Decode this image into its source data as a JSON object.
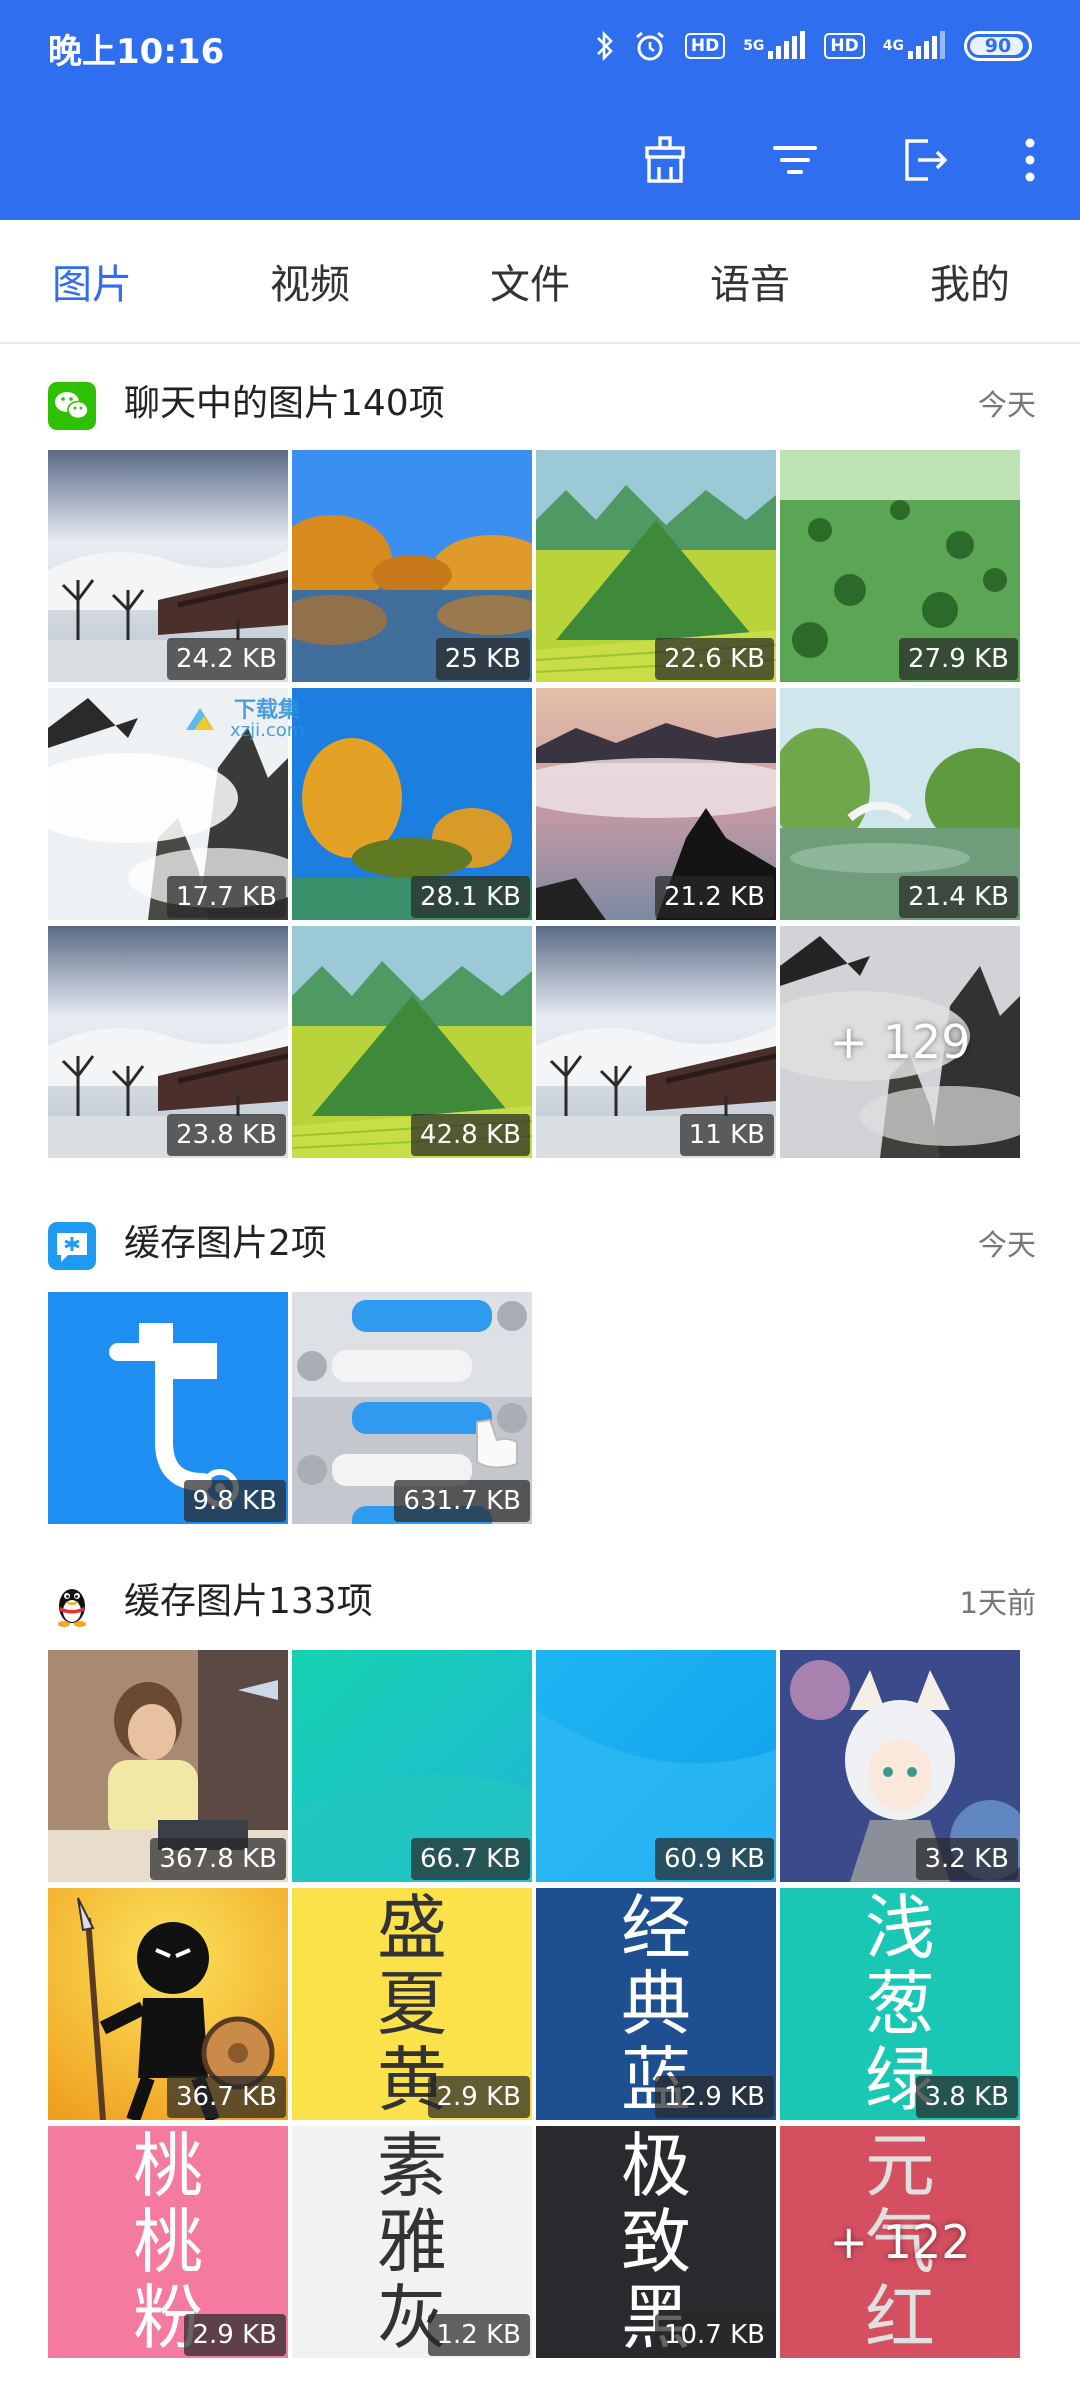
{
  "status_bar": {
    "time": "晚上10:16",
    "battery": "90",
    "hd1": "HD",
    "hd2": "HD",
    "net1": "5G",
    "net2": "4G"
  },
  "tabs": [
    {
      "label": "图片",
      "active": true
    },
    {
      "label": "视频",
      "active": false
    },
    {
      "label": "文件",
      "active": false
    },
    {
      "label": "语音",
      "active": false
    },
    {
      "label": "我的",
      "active": false
    }
  ],
  "sections": [
    {
      "app_icon": "wechat-icon",
      "title": "聊天中的图片140项",
      "date": "今天",
      "tiles": [
        {
          "size": "24.2 KB",
          "art": "misty-village"
        },
        {
          "size": "25 KB",
          "art": "autumn-river"
        },
        {
          "size": "22.6 KB",
          "art": "green-hill"
        },
        {
          "size": "27.9 KB",
          "art": "grassland"
        },
        {
          "size": "17.7 KB",
          "art": "misty-peaks"
        },
        {
          "size": "28.1 KB",
          "art": "autumn-trees"
        },
        {
          "size": "21.2 KB",
          "art": "sunset-peaks"
        },
        {
          "size": "21.4 KB",
          "art": "lake-bridge"
        },
        {
          "size": "23.8 KB",
          "art": "misty-village"
        },
        {
          "size": "42.8 KB",
          "art": "green-hill"
        },
        {
          "size": "11 KB",
          "art": "misty-village"
        },
        {
          "size": "",
          "art": "misty-peaks",
          "more": "+ 129"
        }
      ]
    },
    {
      "app_icon": "cache-app-icon",
      "title": "缓存图片2项",
      "date": "今天",
      "tiles": [
        {
          "size": "9.8 KB",
          "art": "t-logo"
        },
        {
          "size": "631.7 KB",
          "art": "chat-bubbles"
        }
      ]
    },
    {
      "app_icon": "qq-penguin-icon",
      "title": "缓存图片133项",
      "date": "1天前",
      "tiles": [
        {
          "size": "367.8 KB",
          "art": "child-photo"
        },
        {
          "size": "66.7 KB",
          "art": "teal-gradient"
        },
        {
          "size": "60.9 KB",
          "art": "blue-gradient"
        },
        {
          "size": "3.2 KB",
          "art": "anime-avatar"
        },
        {
          "size": "36.7 KB",
          "art": "stickman-warrior"
        },
        {
          "size": "2.9 KB",
          "art": "word",
          "words": [
            "盛",
            "夏",
            "黄"
          ],
          "bg": "#fbe14a",
          "fg": "#333333"
        },
        {
          "size": "12.9 KB",
          "art": "word",
          "words": [
            "经",
            "典",
            "蓝"
          ],
          "bg": "#1d4f91",
          "fg": "#ffffff"
        },
        {
          "size": "3.8 KB",
          "art": "word",
          "words": [
            "浅",
            "葱",
            "绿"
          ],
          "bg": "#19c7b4",
          "fg": "#ffffff"
        },
        {
          "size": "2.9 KB",
          "art": "word",
          "words": [
            "桃",
            "桃",
            "粉"
          ],
          "bg": "#f47aa0",
          "fg": "#ffffff"
        },
        {
          "size": "1.2 KB",
          "art": "word",
          "words": [
            "素",
            "雅",
            "灰"
          ],
          "bg": "#f1f2f4",
          "fg": "#333333"
        },
        {
          "size": "10.7 KB",
          "art": "word",
          "words": [
            "极",
            "致",
            "黑"
          ],
          "bg": "#2a2a2e",
          "fg": "#ffffff"
        },
        {
          "size": "",
          "art": "word",
          "words": [
            "元",
            "气",
            "红"
          ],
          "bg": "#f25a6e",
          "fg": "#ffffff",
          "more": "+ 122"
        }
      ]
    }
  ],
  "watermark": {
    "line1": "下载集",
    "line2": "xzji.com"
  },
  "colors": {
    "accent": "#2f6fef",
    "header_bg": "#2f6fef"
  },
  "toolbar_icons": [
    "clean-icon",
    "filter-icon",
    "export-icon",
    "more-vertical-icon"
  ]
}
